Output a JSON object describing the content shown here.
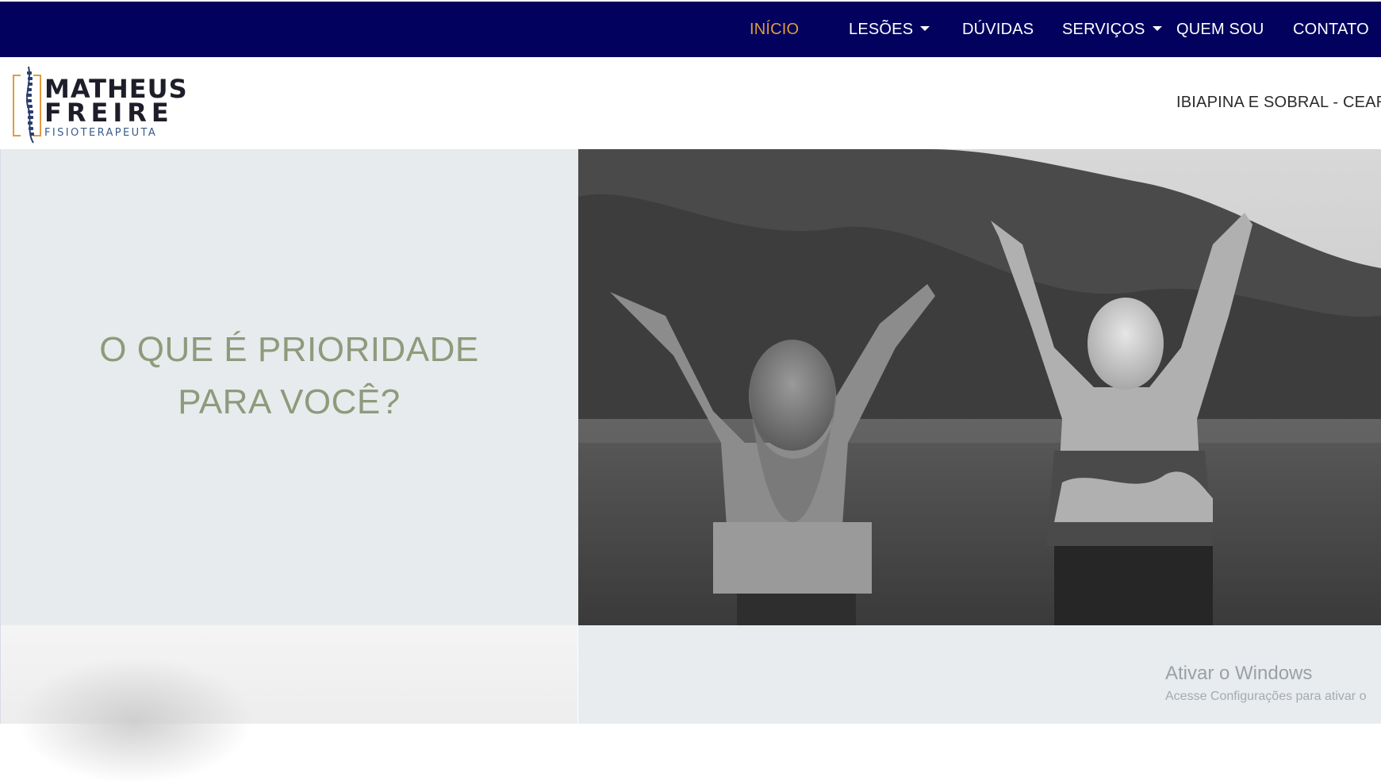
{
  "nav": {
    "items": [
      {
        "label": "INÍCIO",
        "active": true,
        "dropdown": false
      },
      {
        "label": "LESÕES",
        "active": false,
        "dropdown": true
      },
      {
        "label": "DÚVIDAS",
        "active": false,
        "dropdown": false
      },
      {
        "label": "SERVIÇOS",
        "active": false,
        "dropdown": true
      },
      {
        "label": "QUEM SOU",
        "active": false,
        "dropdown": false
      },
      {
        "label": "CONTATO",
        "active": false,
        "dropdown": false
      }
    ],
    "background": "#02025e",
    "active_color": "#e29a3c"
  },
  "header": {
    "logo": {
      "line1": "MATHEUS",
      "line2": "FREIRE",
      "line3": "FISIOTERAPEUTA",
      "icon": "spine-icon"
    },
    "location": "IBIAPINA E SOBRAL - CEARÁ"
  },
  "hero": {
    "heading_line1": "O QUE É PRIORIDADE",
    "heading_line2": "PARA VOCÊ?",
    "heading_color": "#8f9a7b",
    "photo": "black-and-white photo of two women with raised arms facing a forested lake"
  },
  "windows_watermark": {
    "title": "Ativar o Windows",
    "subtitle": "Acesse Configurações para ativar o"
  }
}
